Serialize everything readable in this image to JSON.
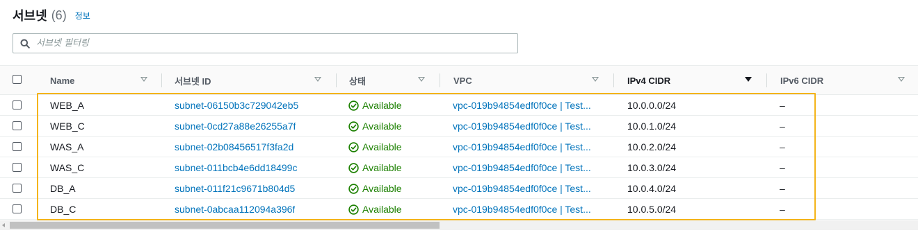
{
  "header": {
    "title": "서브넷",
    "count": "(6)",
    "info_link": "정보"
  },
  "search": {
    "placeholder": "서브넷 필터링",
    "value": ""
  },
  "columns": [
    "Name",
    "서브넷 ID",
    "상태",
    "VPC",
    "IPv4 CIDR",
    "IPv6 CIDR"
  ],
  "sorted_column": "IPv4 CIDR",
  "rows": [
    {
      "name": "WEB_A",
      "subnet_id": "subnet-06150b3c729042eb5",
      "status": "Available",
      "vpc": "vpc-019b94854edf0f0ce | Test...",
      "ipv4": "10.0.0.0/24",
      "ipv6": "–"
    },
    {
      "name": "WEB_C",
      "subnet_id": "subnet-0cd27a88e26255a7f",
      "status": "Available",
      "vpc": "vpc-019b94854edf0f0ce | Test...",
      "ipv4": "10.0.1.0/24",
      "ipv6": "–"
    },
    {
      "name": "WAS_A",
      "subnet_id": "subnet-02b08456517f3fa2d",
      "status": "Available",
      "vpc": "vpc-019b94854edf0f0ce | Test...",
      "ipv4": "10.0.2.0/24",
      "ipv6": "–"
    },
    {
      "name": "WAS_C",
      "subnet_id": "subnet-011bcb4e6dd18499c",
      "status": "Available",
      "vpc": "vpc-019b94854edf0f0ce | Test...",
      "ipv4": "10.0.3.0/24",
      "ipv6": "–"
    },
    {
      "name": "DB_A",
      "subnet_id": "subnet-011f21c9671b804d5",
      "status": "Available",
      "vpc": "vpc-019b94854edf0f0ce | Test...",
      "ipv4": "10.0.4.0/24",
      "ipv6": "–"
    },
    {
      "name": "DB_C",
      "subnet_id": "subnet-0abcaa112094a396f",
      "status": "Available",
      "vpc": "vpc-019b94854edf0f0ce | Test...",
      "ipv4": "10.0.5.0/24",
      "ipv6": "–"
    }
  ],
  "colors": {
    "link": "#0073bb",
    "status_ok": "#1d8102",
    "highlight": "#f4b41a",
    "header_bg": "#fafafa"
  },
  "icons": {
    "search": "search-icon",
    "status": "check-circle-icon",
    "sort": "caret-down-icon"
  }
}
